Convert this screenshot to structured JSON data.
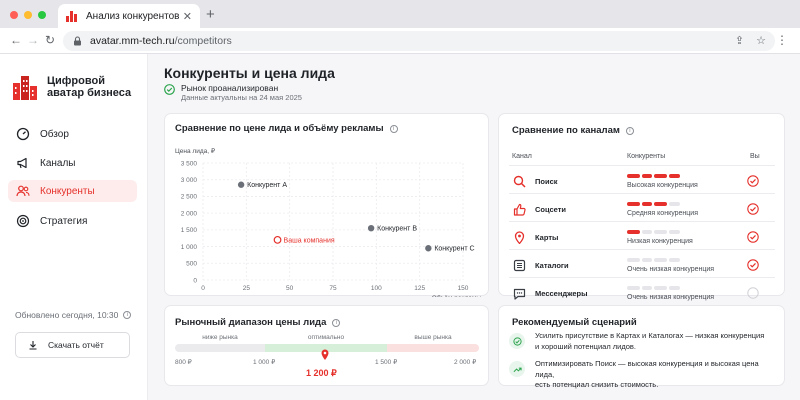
{
  "browser": {
    "tab_title": "Анализ конкурентов",
    "url_host": "avatar.mm-tech.ru",
    "url_path": "/competitors"
  },
  "sidebar": {
    "logo_line1": "Цифровой",
    "logo_line2": "аватар бизнеса",
    "items": [
      {
        "label": "Обзор",
        "icon": "speedometer-icon",
        "active": false
      },
      {
        "label": "Каналы",
        "icon": "megaphone-icon",
        "active": false
      },
      {
        "label": "Конкуренты",
        "icon": "users-icon",
        "active": true
      },
      {
        "label": "Стратегия",
        "icon": "target-icon",
        "active": false
      }
    ],
    "updated": "Обновлено сегодня, 10:30",
    "report_button": "Скачать отчёт"
  },
  "page": {
    "title": "Конкуренты и цена лида",
    "status": "Рынок проанализирован",
    "date_note": "Данные актуальны на 24 мая 2025"
  },
  "scatter_card": {
    "title": "Сравнение по цене лида и объёму рекламы"
  },
  "chart_data": {
    "type": "scatter",
    "title": "Сравнение по цене лида и объёму рекламы",
    "xlabel": "Объём рекламы",
    "ylabel": "Цена лида, ₽",
    "xlim": [
      0,
      150
    ],
    "ylim": [
      0,
      3500
    ],
    "xticks": [
      0,
      25,
      50,
      75,
      100,
      125,
      150
    ],
    "yticks": [
      0,
      500,
      1000,
      1500,
      2000,
      2500,
      3000,
      3500
    ],
    "ytick_labels": [
      "0",
      "500",
      "1 000",
      "1 500",
      "2 000",
      "2 500",
      "3 000",
      "3 500"
    ],
    "grid": true,
    "points": [
      {
        "label": "Конкурент А",
        "x": 22,
        "y": 2850,
        "highlight": false
      },
      {
        "label": "Конкурент В",
        "x": 97,
        "y": 1550,
        "highlight": false
      },
      {
        "label": "Конкурент С",
        "x": 130,
        "y": 950,
        "highlight": false
      },
      {
        "label": "Ваша компания",
        "x": 43,
        "y": 1200,
        "highlight": true
      }
    ]
  },
  "channels_card": {
    "title": "Сравнение по каналам",
    "col_channel": "Канал",
    "col_competitors": "Конкуренты",
    "col_you": "Вы",
    "rows": [
      {
        "name": "Поиск",
        "level": "Высокая конкуренция",
        "filled": 4,
        "you": true,
        "icon": "search-icon"
      },
      {
        "name": "Соцсети",
        "level": "Средняя конкуренция",
        "filled": 3,
        "you": true,
        "icon": "thumbs-up-icon"
      },
      {
        "name": "Карты",
        "level": "Низкая конкуренция",
        "filled": 1,
        "you": true,
        "icon": "map-pin-icon"
      },
      {
        "name": "Каталоги",
        "level": "Очень низкая конкуренция",
        "filled": 0,
        "you": true,
        "icon": "catalog-icon"
      },
      {
        "name": "Мессенджеры",
        "level": "Очень низкая конкуренция",
        "filled": 0,
        "you": false,
        "icon": "chat-icon"
      }
    ]
  },
  "range_card": {
    "title": "Рыночный диапазон цены лида",
    "segments": [
      "ниже рынка",
      "оптимально",
      "выше рынка"
    ],
    "ticks": [
      "800 ₽",
      "1 000 ₽",
      "1 500 ₽",
      "2 000 ₽"
    ],
    "current_value": "1 200 ₽",
    "current_numeric": 1200
  },
  "rec_card": {
    "title": "Рекомендуемый сценарий",
    "items": [
      {
        "icon": "check-icon",
        "line1": "Усилить присутствие в Картах и Каталогах — низкая конкуренция",
        "line2": "и хороший потенциал лидов."
      },
      {
        "icon": "trend-up-icon",
        "line1": "Оптимизировать Поиск — высокая конкуренция и высокая цена лида,",
        "line2": "есть потенциал снизить стоимость."
      }
    ]
  },
  "colors": {
    "accent": "#e5302b",
    "success": "#2da44e",
    "optimal": "#d5efd8"
  }
}
